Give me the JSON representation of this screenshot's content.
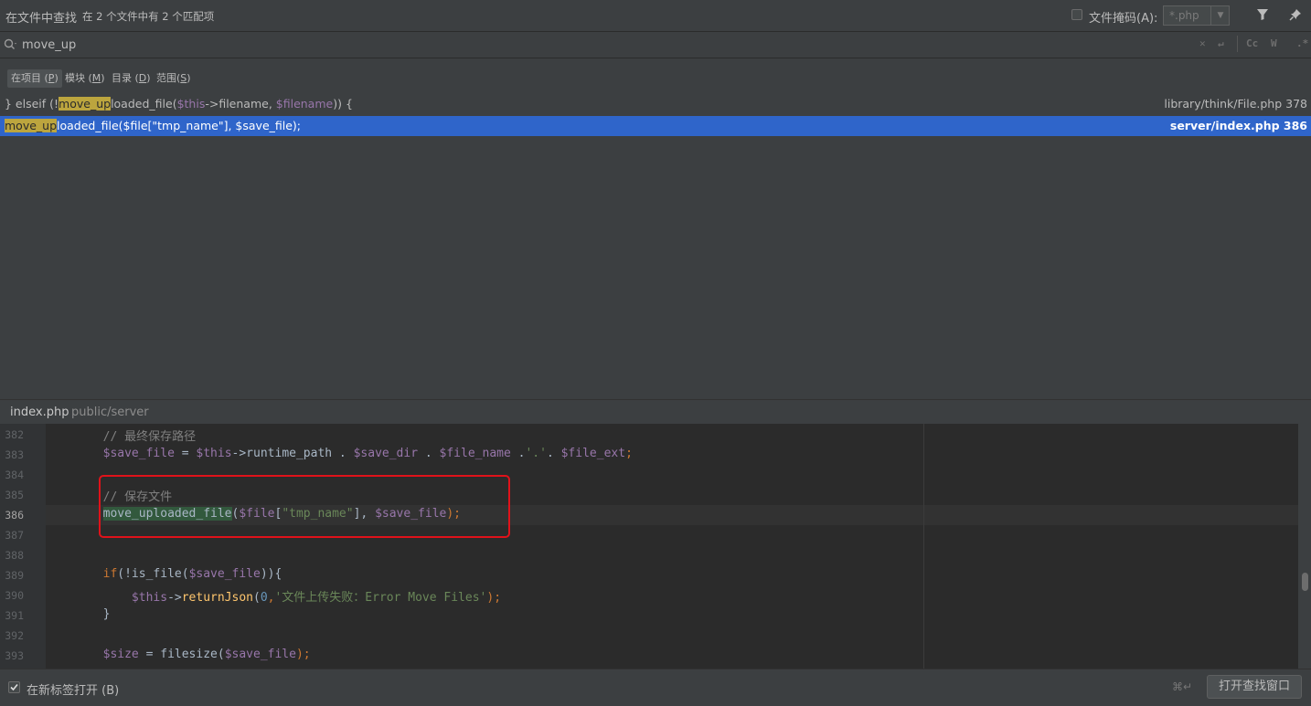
{
  "header": {
    "title": "在文件中查找",
    "match_summary": "在 2 个文件中有 2 个匹配项",
    "file_mask_label": "文件掩码(A):",
    "file_mask_value": "*.php"
  },
  "search": {
    "query": "move_up",
    "case_toggle": "Cc",
    "word_toggle": "W",
    "regex_toggle": ".*"
  },
  "scopes": [
    {
      "label": "在项目",
      "mnemonic": "P",
      "selected": true
    },
    {
      "label": "模块",
      "mnemonic": "M",
      "selected": false
    },
    {
      "label": "目录",
      "mnemonic": "D",
      "selected": false
    },
    {
      "label": "范围",
      "mnemonic": "S",
      "selected": false
    }
  ],
  "results": [
    {
      "prefix": "} elseif (!",
      "match": "move_up",
      "rest_fn": "loaded_file(",
      "arg1": "$this",
      "arrow": "->filename, ",
      "arg2": "$filename",
      "tail": ")) {",
      "location": "library/think/File.php 378",
      "selected": false
    },
    {
      "match": "move_up",
      "rest": "loaded_file($file[\"tmp_name\"], $save_file);",
      "location": "server/index.php 386",
      "selected": true
    }
  ],
  "preview": {
    "filename": "index.php",
    "path": "public/server",
    "current_line": 386,
    "lines": [
      {
        "n": "382",
        "t1": "        // 最终保存路径"
      },
      {
        "n": "383",
        "v1": "$save_file",
        "t1": " = ",
        "v2": "$this",
        "t2": "->runtime_path . ",
        "v3": "$save_dir",
        "t3": " . ",
        "v4": "$file_name",
        "t4": " .",
        "s1": "'.'",
        "t5": ". ",
        "v5": "$file_ext",
        "t6": ";"
      },
      {
        "n": "384"
      },
      {
        "n": "385",
        "t1": "        // 保存文件"
      },
      {
        "n": "386",
        "f1": "move_uploaded_file",
        "t1": "(",
        "v1": "$file",
        "t2": "[",
        "s1": "\"tmp_name\"",
        "t3": "], ",
        "v2": "$save_file",
        "t4": ");"
      },
      {
        "n": "387"
      },
      {
        "n": "388"
      },
      {
        "n": "389",
        "k1": "if",
        "t1": "(!is_file(",
        "v1": "$save_file",
        "t2": ")){"
      },
      {
        "n": "390",
        "v1": "$this",
        "t1": "->",
        "f1": "returnJson",
        "t2": "(",
        "num": "0",
        "t3": ",",
        "s1": "'文件上传失败：Error Move Files'",
        "t4": ");"
      },
      {
        "n": "391",
        "t1": "        }"
      },
      {
        "n": "392"
      },
      {
        "n": "393",
        "v1": "$size",
        "t1": " = filesize(",
        "v2": "$save_file",
        "t2": ");"
      }
    ]
  },
  "footer": {
    "open_in_new_tab_label": "在新标签打开 (B)",
    "open_in_new_tab_checked": true,
    "shortcut": "⌘↵",
    "open_window_button": "打开查找窗口"
  },
  "icons": {
    "filter": "filter-icon",
    "pin": "pin-icon",
    "search": "search-icon",
    "clear": "clear-icon",
    "newline": "newline-icon"
  }
}
